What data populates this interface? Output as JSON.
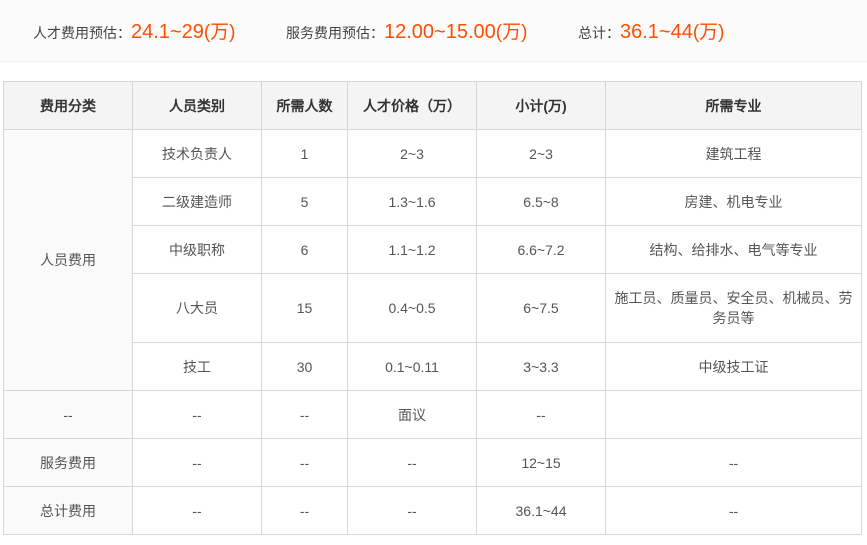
{
  "summary": {
    "talent_label": "人才费用预估：",
    "talent_value": "24.1~29",
    "service_label": "服务费用预估：",
    "service_value": "12.00~15.00",
    "total_label": "总计：",
    "total_value": "36.1~44",
    "unit": "(万)"
  },
  "colors": {
    "highlight": "#ff4e00",
    "subtotal": "#1e8fe0",
    "header_bg": "#f4f4f4",
    "border": "#d6d6d6"
  },
  "table": {
    "headers": [
      "费用分类",
      "人员类别",
      "所需人数",
      "人才价格（万）",
      "小计(万)",
      "所需专业"
    ],
    "personnel_category": "人员费用",
    "personnel_rows": [
      {
        "type": "技术负责人",
        "count": "1",
        "price": "2~3",
        "subtotal": "2~3",
        "major": "建筑工程"
      },
      {
        "type": "二级建造师",
        "count": "5",
        "price": "1.3~1.6",
        "subtotal": "6.5~8",
        "major": "房建、机电专业"
      },
      {
        "type": "中级职称",
        "count": "6",
        "price": "1.1~1.2",
        "subtotal": "6.6~7.2",
        "major": "结构、给排水、电气等专业"
      },
      {
        "type": "八大员",
        "count": "15",
        "price": "0.4~0.5",
        "subtotal": "6~7.5",
        "major": "施工员、质量员、安全员、机械员、劳务员等"
      },
      {
        "type": "技工",
        "count": "30",
        "price": "0.1~0.11",
        "subtotal": "3~3.3",
        "major": "中级技工证"
      }
    ],
    "other_row": {
      "category": "--",
      "type": "--",
      "count": "--",
      "price": "面议",
      "subtotal": "--",
      "major": ""
    },
    "service_row": {
      "category": "服务费用",
      "type": "--",
      "count": "--",
      "price": "--",
      "subtotal": "12~15",
      "major": "--"
    },
    "total_row": {
      "category": "总计费用",
      "type": "--",
      "count": "--",
      "price": "--",
      "subtotal": "36.1~44",
      "major": "--"
    }
  }
}
